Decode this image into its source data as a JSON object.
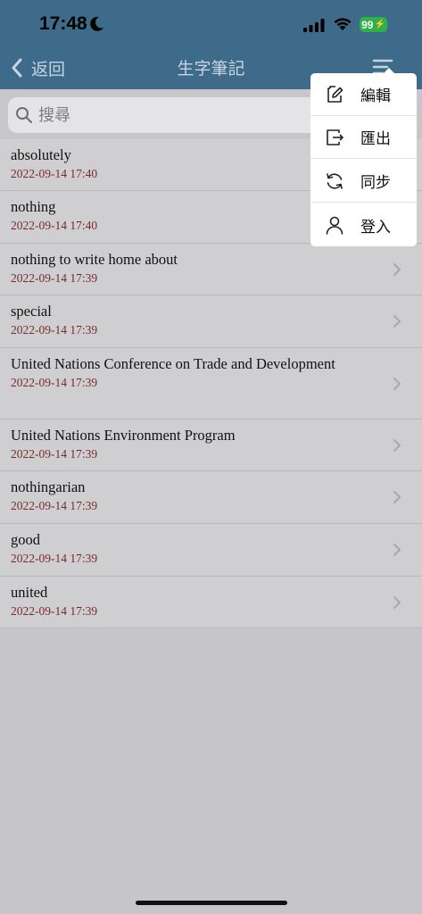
{
  "status_bar": {
    "time": "17:48",
    "battery": "99"
  },
  "nav": {
    "back_label": "返回",
    "title": "生字筆記"
  },
  "search": {
    "placeholder": "搜尋"
  },
  "words": [
    {
      "term": "absolutely",
      "date": "2022-09-14 17:40"
    },
    {
      "term": "nothing",
      "date": "2022-09-14 17:40"
    },
    {
      "term": "nothing to write home about",
      "date": "2022-09-14 17:39"
    },
    {
      "term": "special",
      "date": "2022-09-14 17:39"
    },
    {
      "term": "United Nations Conference on Trade and Development",
      "date": "2022-09-14 17:39"
    },
    {
      "term": "United Nations Environment Program",
      "date": "2022-09-14 17:39"
    },
    {
      "term": "nothingarian",
      "date": "2022-09-14 17:39"
    },
    {
      "term": "good",
      "date": "2022-09-14 17:39"
    },
    {
      "term": "united",
      "date": "2022-09-14 17:39"
    }
  ],
  "menu": {
    "items": [
      {
        "label": "編輯",
        "icon": "edit-icon"
      },
      {
        "label": "匯出",
        "icon": "export-icon"
      },
      {
        "label": "同步",
        "icon": "sync-icon"
      },
      {
        "label": "登入",
        "icon": "user-icon"
      }
    ]
  },
  "colors": {
    "header": "#3f6b8a",
    "date_text": "#7a2a2a",
    "battery": "#2db24a"
  }
}
